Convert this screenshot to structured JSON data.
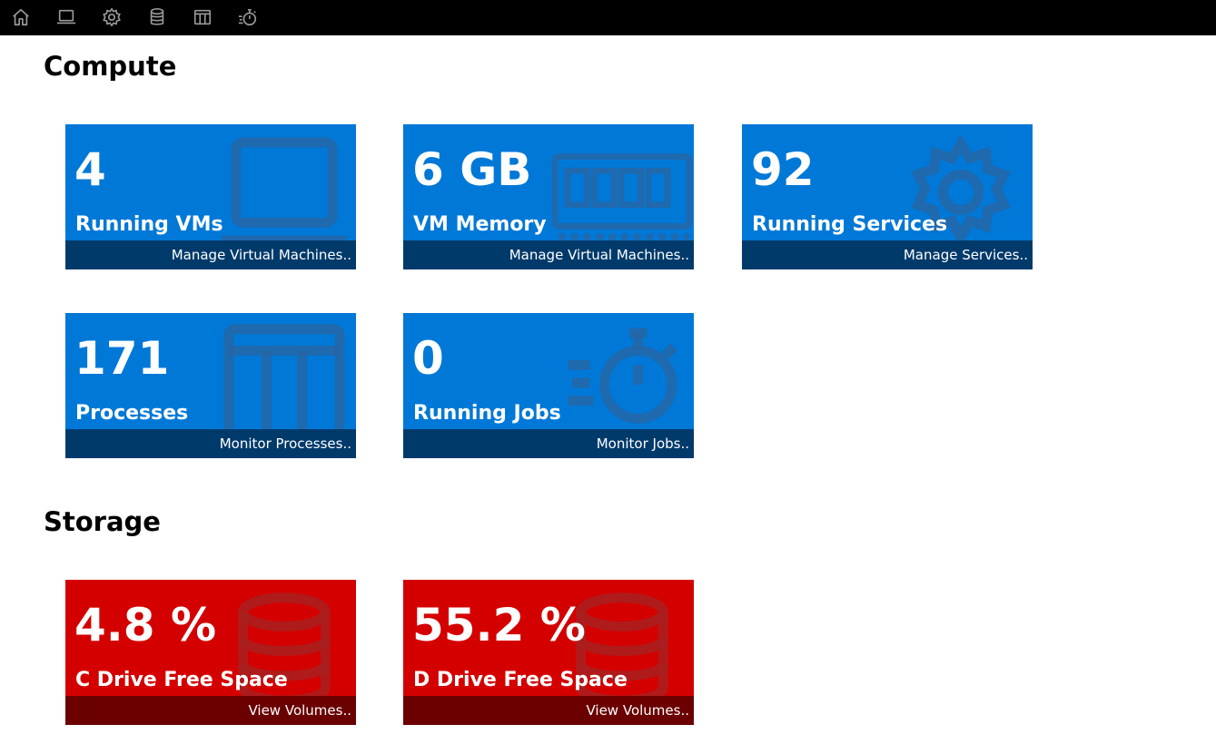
{
  "nav": {
    "items": [
      {
        "icon": "home-icon"
      },
      {
        "icon": "laptop-icon"
      },
      {
        "icon": "gear-icon"
      },
      {
        "icon": "database-icon"
      },
      {
        "icon": "columns-icon"
      },
      {
        "icon": "stopwatch-icon"
      }
    ]
  },
  "compute": {
    "title": "Compute",
    "tiles": [
      {
        "value": "4",
        "label": "Running VMs",
        "link": "Manage Virtual Machines..",
        "icon": "laptop-icon"
      },
      {
        "value": "6 GB",
        "label": "VM Memory",
        "link": "Manage Virtual Machines..",
        "icon": "memory-icon"
      },
      {
        "value": "92",
        "label": "Running Services",
        "link": "Manage Services..",
        "icon": "gear-icon"
      },
      {
        "value": "171",
        "label": "Processes",
        "link": "Monitor Processes..",
        "icon": "columns-icon"
      },
      {
        "value": "0",
        "label": "Running Jobs",
        "link": "Monitor Jobs..",
        "icon": "stopwatch-icon"
      }
    ]
  },
  "storage": {
    "title": "Storage",
    "tiles": [
      {
        "value": "4.8 %",
        "label": "C Drive Free Space",
        "link": "View Volumes..",
        "icon": "database-icon"
      },
      {
        "value": "55.2 %",
        "label": "D Drive Free Space",
        "link": "View Volumes..",
        "icon": "database-icon"
      }
    ]
  },
  "colors": {
    "topbar": "#000000",
    "tile_blue": "#0078d7",
    "tile_blue_footer": "#003a6b",
    "tile_red": "#d40000",
    "tile_red_footer": "#6b0000",
    "nav_icon": "#9a9a9a"
  }
}
